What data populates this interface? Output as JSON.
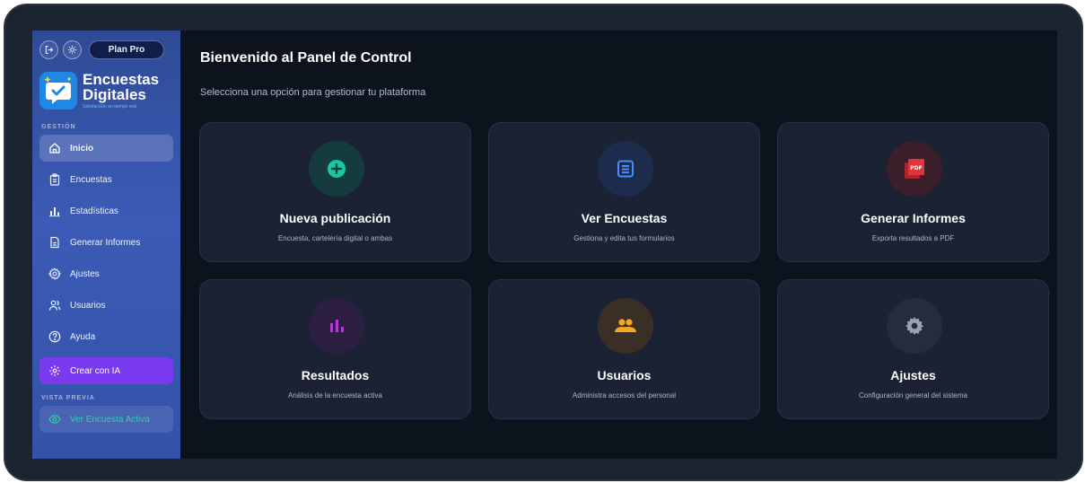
{
  "sidebar": {
    "plan_label": "Plan Pro",
    "brand_title_line1": "Encuestas",
    "brand_title_line2": "Digitales",
    "brand_tagline": "Satisfacción en tiempo real",
    "section_gestion": "GESTIÓN",
    "items": [
      {
        "label": "Inicio",
        "icon": "home-icon"
      },
      {
        "label": "Encuestas",
        "icon": "clipboard-icon"
      },
      {
        "label": "Estadísticas",
        "icon": "bar-chart-icon"
      },
      {
        "label": "Generar Informes",
        "icon": "document-icon"
      },
      {
        "label": "Ajustes",
        "icon": "gear-icon"
      },
      {
        "label": "Usuarios",
        "icon": "users-icon"
      },
      {
        "label": "Ayuda",
        "icon": "help-icon"
      }
    ],
    "ai_button": "Crear con IA",
    "section_preview": "VISTA PREVIA",
    "preview_button": "Ver Encuesta Activa"
  },
  "main": {
    "title": "Bienvenido al Panel de Control",
    "subtitle": "Selecciona una opción para gestionar tu plataforma",
    "cards": [
      {
        "title": "Nueva publicación",
        "desc": "Encuesta, cartelería digital o ambas",
        "icon": "plus-circle-icon",
        "color": "#14c8a0"
      },
      {
        "title": "Ver Encuestas",
        "desc": "Gestiona y edita tus formularios",
        "icon": "list-icon",
        "color": "#4a8cff"
      },
      {
        "title": "Generar Informes",
        "desc": "Exporta resultados a PDF",
        "icon": "pdf-icon",
        "color": "#e0353b"
      },
      {
        "title": "Resultados",
        "desc": "Análisis de la encuesta activa",
        "icon": "bar-chart-icon",
        "color": "#b03ecf"
      },
      {
        "title": "Usuarios",
        "desc": "Administra accesos del personal",
        "icon": "users-icon",
        "color": "#f5a623"
      },
      {
        "title": "Ajustes",
        "desc": "Configuración general del sistema",
        "icon": "gear-icon",
        "color": "#9aa3b2"
      }
    ]
  },
  "colors": {
    "sidebar": "#3b5bb6",
    "background": "#0d131d",
    "card": "#1a2233",
    "accent_ai": "#7a3af0",
    "accent_preview": "#2fd3a6"
  }
}
